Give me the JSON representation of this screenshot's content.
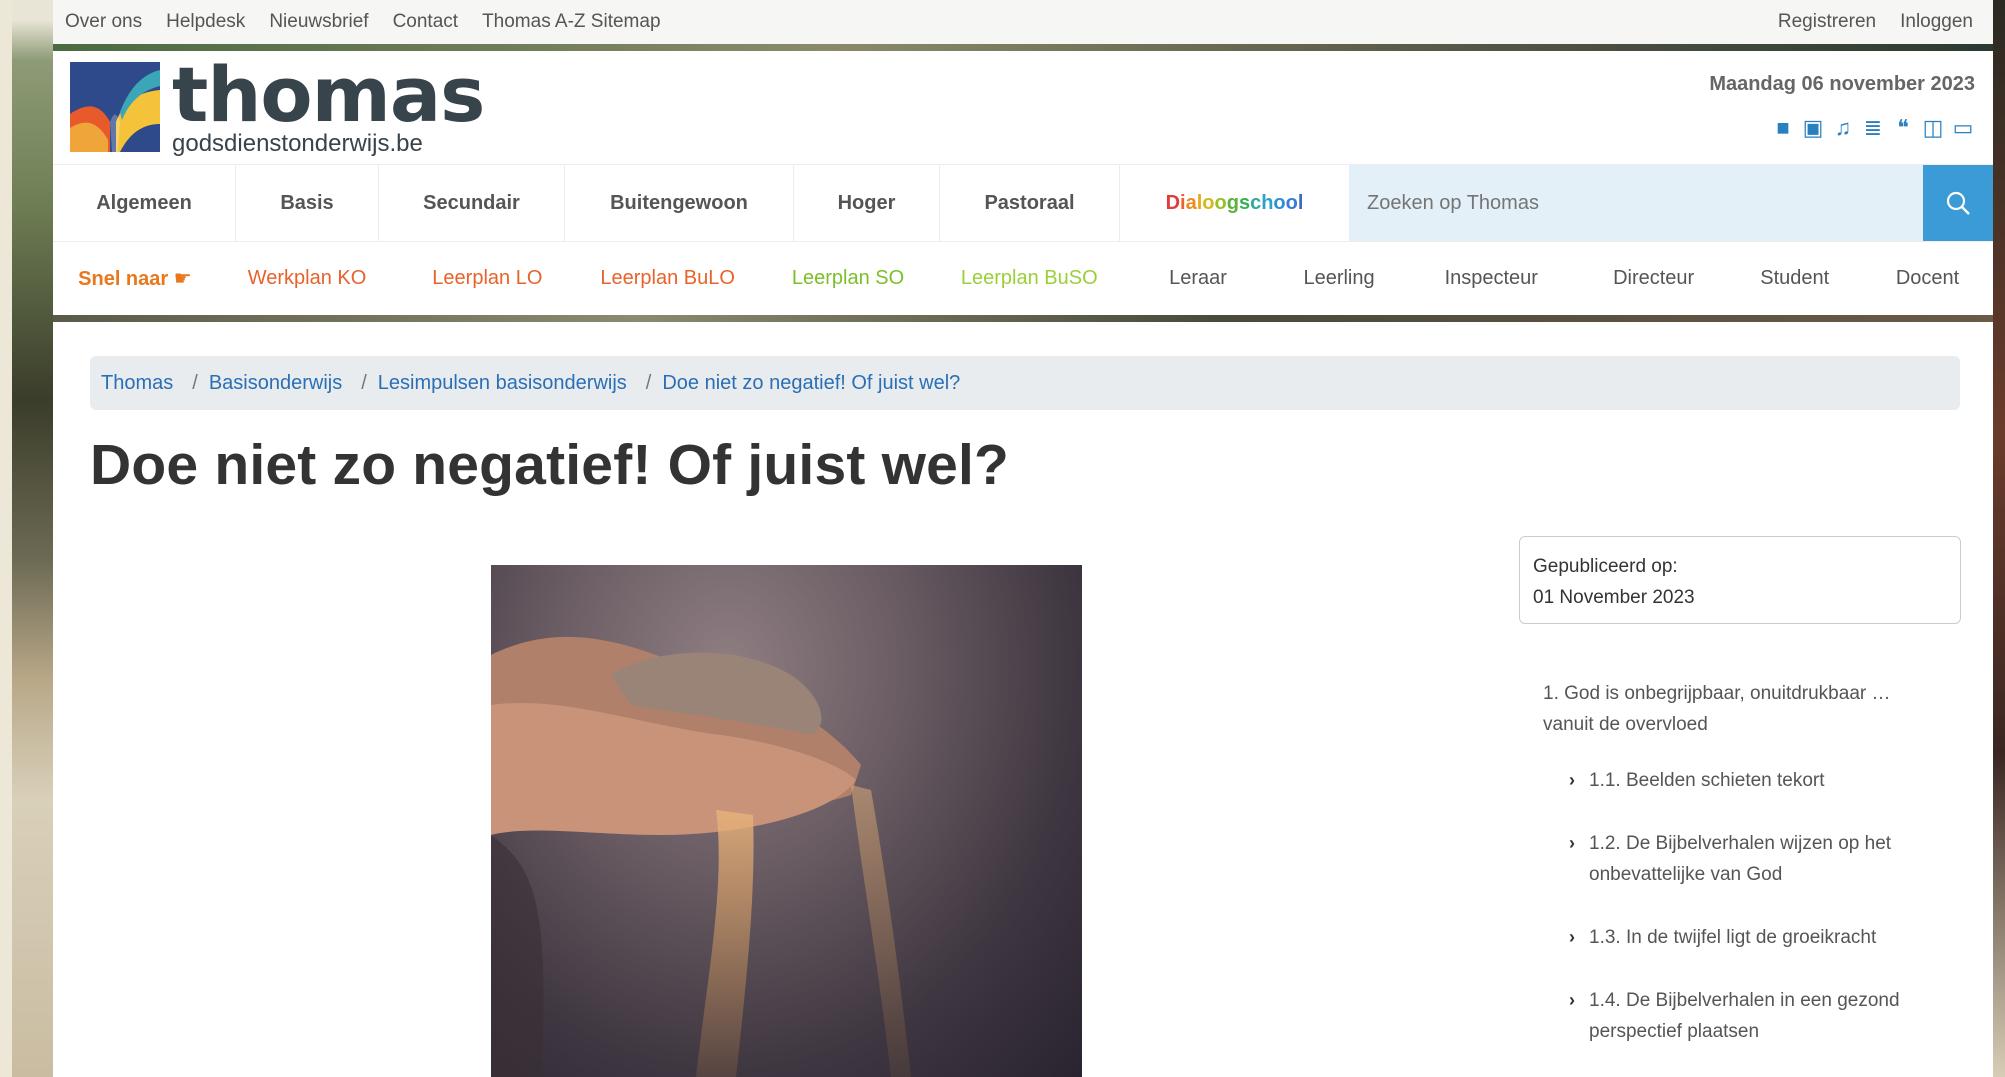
{
  "utility": {
    "left": [
      "Over ons",
      "Helpdesk",
      "Nieuwsbrief",
      "Contact",
      "Thomas A-Z Sitemap"
    ],
    "right": [
      "Registreren",
      "Inloggen"
    ]
  },
  "header": {
    "logo_word": "thomas",
    "logo_sub": "godsdienstonderwijs.be",
    "date": "Maandag 06 november 2023",
    "media_icons": [
      "video-icon",
      "image-icon",
      "music-icon",
      "text-icon",
      "quote-icon",
      "book-icon",
      "screen-icon"
    ]
  },
  "mainnav": {
    "items": [
      "Algemeen",
      "Basis",
      "Secundair",
      "Buitengewoon",
      "Hoger",
      "Pastoraal"
    ],
    "dialoog": [
      "D",
      "i",
      "a",
      "l",
      "o",
      "o",
      "g",
      "s",
      "c",
      "h",
      "o",
      "o",
      "l"
    ],
    "dialoog_colors": [
      "#e23b3b",
      "#e8622b",
      "#ef8a1c",
      "#e7a81b",
      "#d7b71c",
      "#9bbf2a",
      "#5bb13a",
      "#3aae55",
      "#2fa9a0",
      "#2aa2c9",
      "#2f8fd6",
      "#3a7ccf",
      "#3a6cc2"
    ],
    "search_placeholder": "Zoeken op Thomas"
  },
  "subnav": {
    "snel": "Snel naar",
    "items": [
      {
        "label": "Werkplan KO",
        "color": "#e8622b"
      },
      {
        "label": "Leerplan LO",
        "color": "#e8622b"
      },
      {
        "label": "Leerplan BuLO",
        "color": "#e8622b"
      },
      {
        "label": "Leerplan SO",
        "color": "#7bbf2a"
      },
      {
        "label": "Leerplan BuSO",
        "color": "#9bcf3a"
      },
      {
        "label": "Leraar",
        "color": "#555555"
      },
      {
        "label": "Leerling",
        "color": "#555555"
      },
      {
        "label": "Inspecteur",
        "color": "#555555"
      },
      {
        "label": "Directeur",
        "color": "#555555"
      },
      {
        "label": "Student",
        "color": "#555555"
      },
      {
        "label": "Docent",
        "color": "#555555"
      }
    ]
  },
  "breadcrumb": [
    "Thomas",
    "Basisonderwijs",
    "Lesimpulsen basisonderwijs",
    "Doe niet zo negatief! Of juist wel?"
  ],
  "title": "Doe niet zo negatief! Of juist wel?",
  "published": {
    "label": "Gepubliceerd op:",
    "date": "01 November 2023"
  },
  "toc": {
    "top": "1. God is onbegrijpbaar, onuitdrukbaar … vanuit de overvloed",
    "items": [
      "1.1. Beelden schieten tekort",
      "1.2. De Bijbelverhalen wijzen op het onbevattelijke van God",
      "1.3. In de twijfel ligt de groeikracht",
      "1.4. De Bijbelverhalen in een gezond perspectief plaatsen"
    ]
  }
}
